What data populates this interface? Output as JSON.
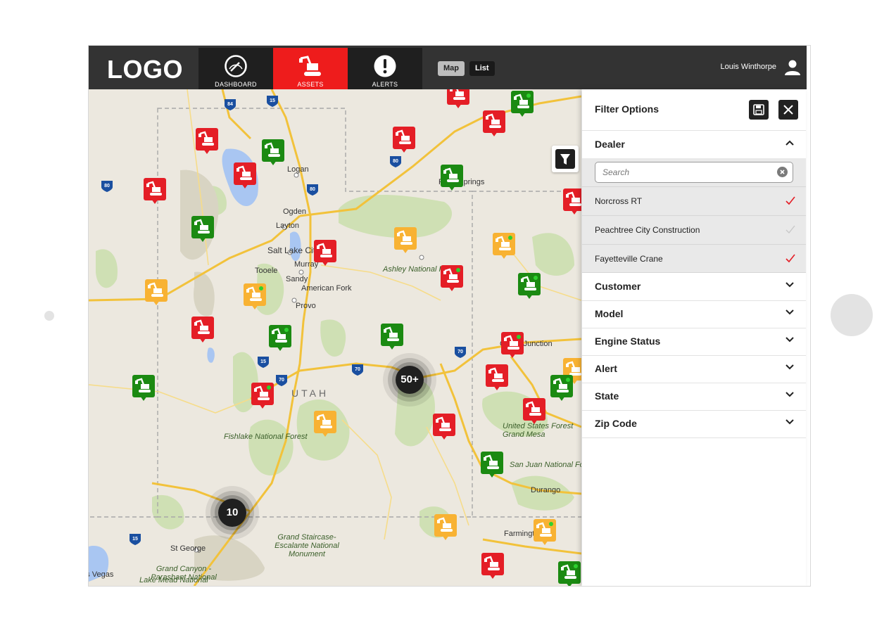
{
  "header": {
    "logo": "LOGO",
    "nav": [
      {
        "label": "DASHBOARD",
        "icon": "gauge-icon"
      },
      {
        "label": "ASSETS",
        "icon": "excavator-icon",
        "active": true
      },
      {
        "label": "ALERTS",
        "icon": "exclamation-icon"
      }
    ],
    "view_toggle": {
      "map": "Map",
      "list": "List",
      "selected": "Map"
    },
    "user_name": "Louis Winthorpe"
  },
  "map": {
    "labels": [
      "Logan",
      "Ogden",
      "Layton",
      "Salt Lake City",
      "Tooele",
      "Murray",
      "Sandy",
      "American Fork",
      "Provo",
      "Rock Springs",
      "Ashley National Forest",
      "UTAH",
      "Fishlake National Forest",
      "Grand Staircase-Escalante National Monument",
      "St George",
      "Grand Canyon - Parashant National",
      "Las Vegas",
      "Lake Mead National",
      "Grand Junction",
      "United States Forest Grand Mesa",
      "San Juan National Fo",
      "Durango",
      "Farmington"
    ],
    "clusters": [
      "50+",
      "10"
    ],
    "pin_status_colors": {
      "red": "#e41e26",
      "green": "#1b8a12",
      "orange": "#f8b233"
    }
  },
  "filter_panel": {
    "title": "Filter Options",
    "dealer": {
      "title": "Dealer",
      "search_placeholder": "Search",
      "options": [
        {
          "label": "Norcross RT",
          "checked": true
        },
        {
          "label": "Peachtree City Construction",
          "checked": false
        },
        {
          "label": "Fayetteville Crane",
          "checked": true
        }
      ]
    },
    "sections": [
      "Customer",
      "Model",
      "Engine Status",
      "Alert",
      "State",
      "Zip Code"
    ]
  }
}
